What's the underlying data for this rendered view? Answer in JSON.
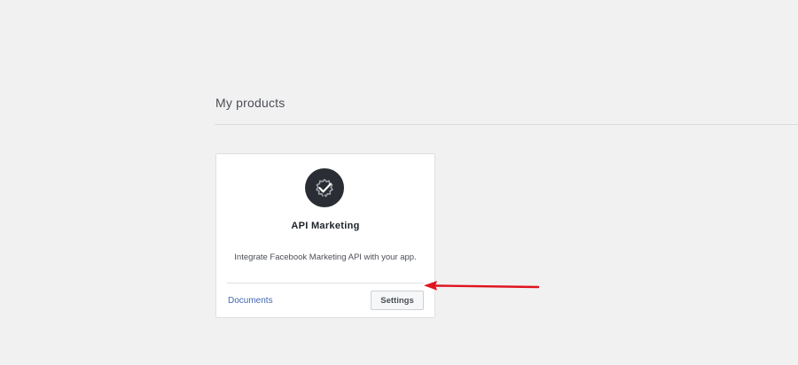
{
  "section": {
    "title": "My products"
  },
  "product": {
    "icon": "gear-check-icon",
    "title": "API Marketing",
    "description": "Integrate Facebook Marketing API with your app.",
    "documents_label": "Documents",
    "settings_label": "Settings"
  },
  "colors": {
    "background": "#f1f1f1",
    "link": "#4267b2",
    "annotation_arrow": "#e0141e",
    "icon_bg": "#2a2d33"
  }
}
